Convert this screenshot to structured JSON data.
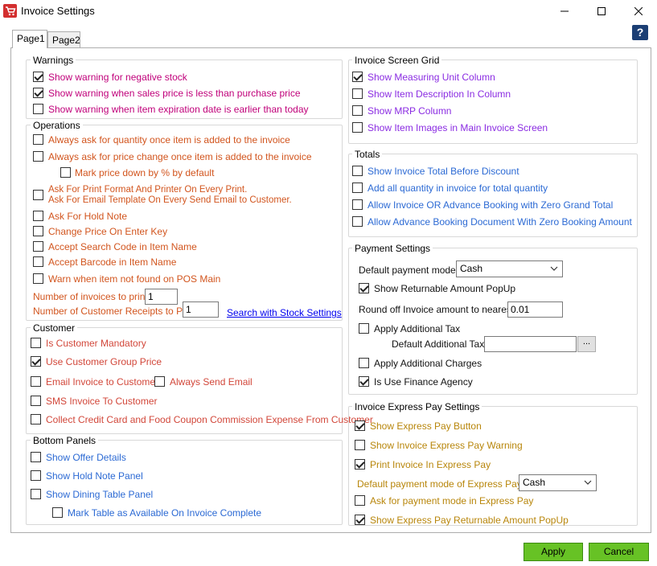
{
  "window": {
    "title": "Invoice Settings"
  },
  "tabs": [
    {
      "label": "Page1"
    },
    {
      "label": "Page2"
    }
  ],
  "help": {
    "label": "?"
  },
  "warnings": {
    "title": "Warnings",
    "items": [
      {
        "label": "Show warning for negative stock",
        "checked": true
      },
      {
        "label": "Show warning when sales price is less than purchase price",
        "checked": true
      },
      {
        "label": "Show warning when item expiration date is earlier than today",
        "checked": false
      }
    ]
  },
  "operations": {
    "title": "Operations",
    "ask_quantity": "Always ask for quantity once item is added to the invoice",
    "ask_price": "Always ask for price change once item is added to the invoice",
    "mark_down": "Mark price down by % by default",
    "print_format_line1": "Ask For Print Format And  Printer On Every Print.",
    "print_format_line2": "Ask For Email Template On Every Send Email to Customer.",
    "hold_note": "Ask For Hold Note",
    "change_price": "Change Price On Enter Key",
    "search_code": "Accept Search Code in Item Name",
    "barcode": "Accept Barcode in Item Name",
    "warn_pos": "Warn when item not found on POS Main",
    "invoices_label": "Number of invoices to print :",
    "invoices_value": "1",
    "receipts_label": "Number of Customer Receipts to Print :",
    "receipts_value": "1",
    "stock_link": "Search with Stock Settings"
  },
  "customer": {
    "title": "Customer",
    "mandatory": "Is Customer Mandatory",
    "group_price": "Use Customer Group Price",
    "email_invoice": "Email Invoice to Customer",
    "always_email": "Always Send Email",
    "sms": "SMS Invoice To Customer",
    "commission": "Collect Credit Card and Food Coupon Commission Expense From Customer"
  },
  "bottom_panels": {
    "title": "Bottom Panels",
    "offer": "Show Offer Details",
    "hold_note": "Show Hold Note Panel",
    "dining": "Show Dining Table Panel",
    "mark_table": "Mark Table as Available On Invoice Complete"
  },
  "screen_grid": {
    "title": "Invoice Screen Grid",
    "measuring": "Show Measuring Unit Column",
    "description": "Show Item Description In Column",
    "mrp": "Show MRP Column",
    "images": "Show Item Images in Main Invoice Screen"
  },
  "totals": {
    "title": "Totals",
    "before_discount": "Show Invoice Total Before Discount",
    "all_quantity": "Add all quantity in invoice for total quantity",
    "zero_grand": "Allow Invoice OR Advance Booking with Zero Grand Total",
    "zero_booking": "Allow Advance Booking Document With Zero Booking Amount"
  },
  "payment": {
    "title": "Payment Settings",
    "mode_label": "Default payment mode :",
    "mode_value": "Cash",
    "returnable": "Show Returnable Amount PopUp",
    "round_label": "Round off Invoice amount to nearest :",
    "round_value": "0.01",
    "additional_tax": "Apply Additional Tax",
    "default_tax_label": "Default Additional Tax :",
    "default_tax_value": "",
    "browse": "...",
    "additional_charges": "Apply Additional Charges",
    "finance": "Is Use Finance Agency"
  },
  "express": {
    "title": "Invoice Express Pay Settings",
    "show_button": "Show Express Pay Button",
    "show_warning": "Show Invoice Express Pay Warning",
    "print": "Print Invoice In Express Pay",
    "mode_label": "Default payment mode of Express Pay :",
    "mode_value": "Cash",
    "ask_mode": "Ask for payment mode in Express Pay",
    "returnable": "Show Express Pay Returnable Amount PopUp"
  },
  "buttons": {
    "apply": "Apply",
    "cancel": "Cancel"
  },
  "colors": {
    "button_green": "#67c225",
    "help_blue": "#1b3e74"
  }
}
